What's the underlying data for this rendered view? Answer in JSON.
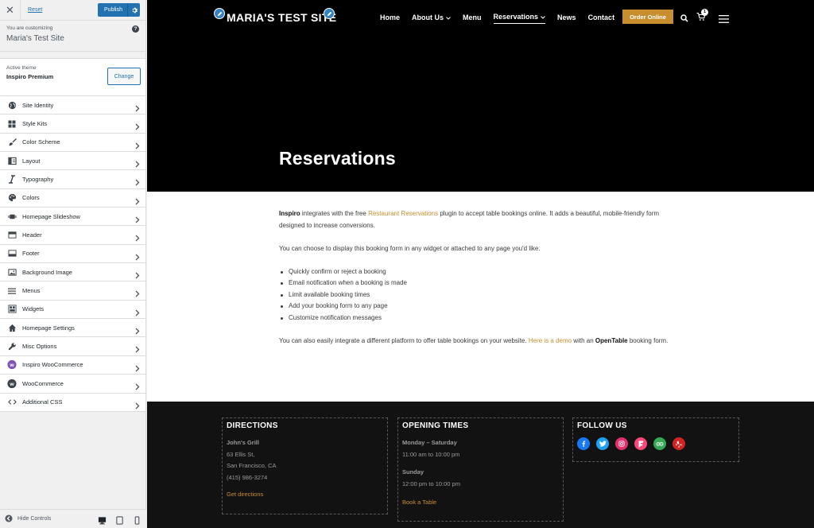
{
  "sidebar": {
    "reset_label": "Reset",
    "publish_label": "Publish",
    "customizing_label": "You are customizing",
    "site_name": "Maria's Test Site",
    "active_theme_label": "Active theme",
    "theme_name": "Inspiro Premium",
    "change_label": "Change",
    "items": [
      {
        "label": "Site Identity",
        "icon": "globe-icon"
      },
      {
        "label": "Style Kits",
        "icon": "grid-icon"
      },
      {
        "label": "Color Scheme",
        "icon": "brush-icon"
      },
      {
        "label": "Layout",
        "icon": "layout-icon"
      },
      {
        "label": "Typography",
        "icon": "italic-icon"
      },
      {
        "label": "Colors",
        "icon": "palette-icon"
      },
      {
        "label": "Homepage Slideshow",
        "icon": "slides-icon"
      },
      {
        "label": "Header",
        "icon": "header-icon"
      },
      {
        "label": "Footer",
        "icon": "footer-icon"
      },
      {
        "label": "Background Image",
        "icon": "image-icon"
      },
      {
        "label": "Menus",
        "icon": "menu-icon"
      },
      {
        "label": "Widgets",
        "icon": "widgets-icon"
      },
      {
        "label": "Homepage Settings",
        "icon": "home-icon"
      },
      {
        "label": "Misc Options",
        "icon": "wrench-icon"
      },
      {
        "label": "Inspiro WooCommerce",
        "icon": "woo-purple-icon"
      },
      {
        "label": "WooCommerce",
        "icon": "woo-dark-icon"
      },
      {
        "label": "Additional CSS",
        "icon": "code-icon"
      }
    ],
    "hide_controls_label": "Hide Controls"
  },
  "site": {
    "logo": "MARIA'S TEST SITE",
    "nav": [
      {
        "label": "Home",
        "dropdown": false,
        "active": false
      },
      {
        "label": "About Us",
        "dropdown": true,
        "active": false
      },
      {
        "label": "Menu",
        "dropdown": false,
        "active": false
      },
      {
        "label": "Reservations",
        "dropdown": true,
        "active": true
      },
      {
        "label": "News",
        "dropdown": false,
        "active": false
      },
      {
        "label": "Contact",
        "dropdown": false,
        "active": false
      }
    ],
    "order_button": "Order Online",
    "cart_count": "1",
    "page_title": "Reservations",
    "content": {
      "p1_bold": "Inspiro",
      "p1_a": " integrates with the free ",
      "p1_link": "Restaurant Reservations",
      "p1_b": " plugin to accept table bookings online. It adds a beautiful, mobile-friendly form designed to increase conversions.",
      "p2": "You can choose to display this booking form in any widget or attached to any page you'd like.",
      "bullets": [
        "Quickly confirm or reject a booking",
        "Email notification when a booking is made",
        "Limit available booking times",
        "Add your booking form to any page",
        "Customize notification messages"
      ],
      "p3_a": "You can also easily integrate a different platform to offer table bookings on your website. ",
      "p3_link": "Here is a demo",
      "p3_b": " with an ",
      "p3_bold": "OpenTable",
      "p3_c": " booking form."
    },
    "footer": {
      "directions": {
        "title": "DIRECTIONS",
        "name": "John's Grill",
        "address1": "63 Ellis St,",
        "address2": "San Francisco, CA",
        "phone": "(415) 986-3274",
        "link": "Get directions"
      },
      "hours": {
        "title": "OPENING TIMES",
        "day1": "Monday – Saturday",
        "time1": "11:00 am to 10:00 pm",
        "day2": "Sunday",
        "time2": "12:00 pm to 10:00 pm",
        "link": "Book a Table"
      },
      "follow": {
        "title": "FOLLOW US",
        "socials": [
          {
            "icon": "facebook-icon",
            "color": "#1877f2"
          },
          {
            "icon": "twitter-icon",
            "color": "#1da1f2"
          },
          {
            "icon": "instagram-icon",
            "color": "#e1306c"
          },
          {
            "icon": "foursquare-icon",
            "color": "#f94877"
          },
          {
            "icon": "tripadvisor-icon",
            "color": "#34a853"
          },
          {
            "icon": "yelp-icon",
            "color": "#d32323"
          }
        ]
      }
    }
  },
  "colors": {
    "accent": "#c88e2e",
    "wp_blue": "#2271b1"
  }
}
